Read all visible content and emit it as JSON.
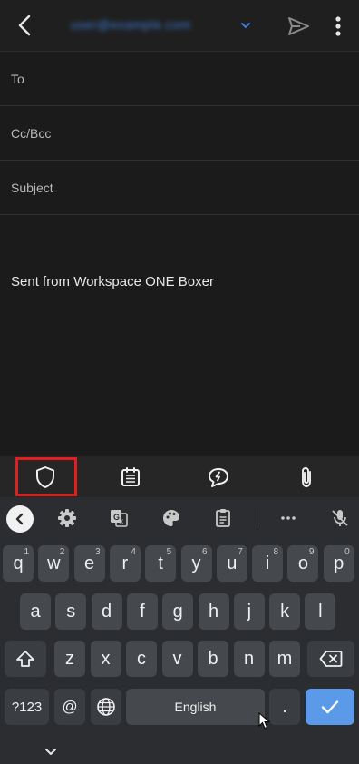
{
  "app": {
    "from_account": "user@example.com"
  },
  "fields": {
    "to_label": "To",
    "cc_label": "Cc/Bcc",
    "subject_label": "Subject"
  },
  "body": {
    "signature": "Sent from Workspace ONE Boxer"
  },
  "toolbar": {
    "icons": [
      "shield-icon",
      "calendar-icon",
      "quick-reply-icon",
      "attachment-icon"
    ],
    "highlight_color": "#e01f1f"
  },
  "keyboard": {
    "row1": [
      {
        "k": "q",
        "h": "1"
      },
      {
        "k": "w",
        "h": "2"
      },
      {
        "k": "e",
        "h": "3"
      },
      {
        "k": "r",
        "h": "4"
      },
      {
        "k": "t",
        "h": "5"
      },
      {
        "k": "y",
        "h": "6"
      },
      {
        "k": "u",
        "h": "7"
      },
      {
        "k": "i",
        "h": "8"
      },
      {
        "k": "o",
        "h": "9"
      },
      {
        "k": "p",
        "h": "0"
      }
    ],
    "row2": [
      "a",
      "s",
      "d",
      "f",
      "g",
      "h",
      "j",
      "k",
      "l"
    ],
    "row3": [
      "z",
      "x",
      "c",
      "v",
      "b",
      "n",
      "m"
    ],
    "symbols_label": "?123",
    "at_label": "@",
    "space_label": "English",
    "period_label": ".",
    "enter_color": "#5b9ae9"
  }
}
